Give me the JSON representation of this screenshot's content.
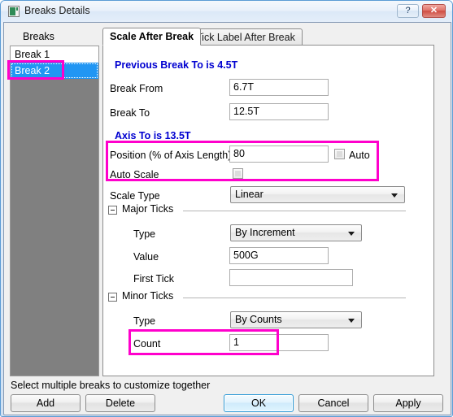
{
  "window": {
    "title": "Breaks Details",
    "icon": "app-window-icon",
    "help_label": "?",
    "close_label": "✕"
  },
  "sidebar": {
    "label": "Breaks",
    "items": [
      {
        "label": "Break 1",
        "selected": false
      },
      {
        "label": "Break 2",
        "selected": true
      }
    ]
  },
  "tabs": [
    {
      "label": "Scale After Break",
      "active": true
    },
    {
      "label": "Tick Label After Break",
      "active": false
    }
  ],
  "form": {
    "previous_break_note": "Previous Break To is 4.5T",
    "break_from_label": "Break From",
    "break_from_value": "6.7T",
    "break_to_label": "Break To",
    "break_to_value": "12.5T",
    "axis_to_note": "Axis To is 13.5T",
    "position_label": "Position (% of Axis Length)",
    "position_value": "80",
    "position_auto_label": "Auto",
    "auto_scale_label": "Auto Scale",
    "scale_type_label": "Scale Type",
    "scale_type_value": "Linear",
    "major_ticks_group": "Major Ticks",
    "major_type_label": "Type",
    "major_type_value": "By Increment",
    "major_value_label": "Value",
    "major_value_value": "500G",
    "major_first_tick_label": "First Tick",
    "major_first_tick_value": "",
    "minor_ticks_group": "Minor Ticks",
    "minor_type_label": "Type",
    "minor_type_value": "By Counts",
    "minor_count_label": "Count",
    "minor_count_value": "1"
  },
  "footer": {
    "status": "Select multiple breaks to customize together",
    "add_label": "Add",
    "delete_label": "Delete",
    "ok_label": "OK",
    "cancel_label": "Cancel",
    "apply_label": "Apply"
  },
  "colors": {
    "highlight": "#ff00cc",
    "note_text": "#0000d0",
    "selection": "#2196f3"
  }
}
